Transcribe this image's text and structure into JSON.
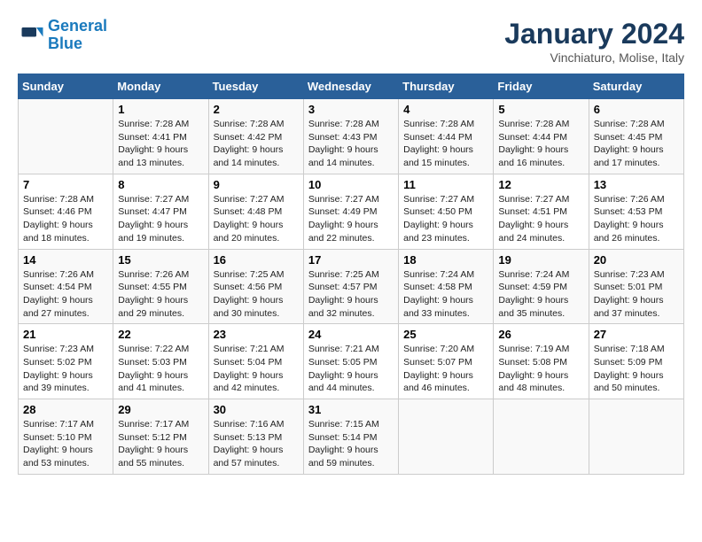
{
  "logo": {
    "line1": "General",
    "line2": "Blue"
  },
  "title": "January 2024",
  "subtitle": "Vinchiaturo, Molise, Italy",
  "days_of_week": [
    "Sunday",
    "Monday",
    "Tuesday",
    "Wednesday",
    "Thursday",
    "Friday",
    "Saturday"
  ],
  "weeks": [
    [
      {
        "day": "",
        "empty": true
      },
      {
        "day": "1",
        "sunrise": "7:28 AM",
        "sunset": "4:41 PM",
        "daylight": "9 hours and 13 minutes."
      },
      {
        "day": "2",
        "sunrise": "7:28 AM",
        "sunset": "4:42 PM",
        "daylight": "9 hours and 14 minutes."
      },
      {
        "day": "3",
        "sunrise": "7:28 AM",
        "sunset": "4:43 PM",
        "daylight": "9 hours and 14 minutes."
      },
      {
        "day": "4",
        "sunrise": "7:28 AM",
        "sunset": "4:44 PM",
        "daylight": "9 hours and 15 minutes."
      },
      {
        "day": "5",
        "sunrise": "7:28 AM",
        "sunset": "4:44 PM",
        "daylight": "9 hours and 16 minutes."
      },
      {
        "day": "6",
        "sunrise": "7:28 AM",
        "sunset": "4:45 PM",
        "daylight": "9 hours and 17 minutes."
      }
    ],
    [
      {
        "day": "7",
        "sunrise": "7:28 AM",
        "sunset": "4:46 PM",
        "daylight": "9 hours and 18 minutes."
      },
      {
        "day": "8",
        "sunrise": "7:27 AM",
        "sunset": "4:47 PM",
        "daylight": "9 hours and 19 minutes."
      },
      {
        "day": "9",
        "sunrise": "7:27 AM",
        "sunset": "4:48 PM",
        "daylight": "9 hours and 20 minutes."
      },
      {
        "day": "10",
        "sunrise": "7:27 AM",
        "sunset": "4:49 PM",
        "daylight": "9 hours and 22 minutes."
      },
      {
        "day": "11",
        "sunrise": "7:27 AM",
        "sunset": "4:50 PM",
        "daylight": "9 hours and 23 minutes."
      },
      {
        "day": "12",
        "sunrise": "7:27 AM",
        "sunset": "4:51 PM",
        "daylight": "9 hours and 24 minutes."
      },
      {
        "day": "13",
        "sunrise": "7:26 AM",
        "sunset": "4:53 PM",
        "daylight": "9 hours and 26 minutes."
      }
    ],
    [
      {
        "day": "14",
        "sunrise": "7:26 AM",
        "sunset": "4:54 PM",
        "daylight": "9 hours and 27 minutes."
      },
      {
        "day": "15",
        "sunrise": "7:26 AM",
        "sunset": "4:55 PM",
        "daylight": "9 hours and 29 minutes."
      },
      {
        "day": "16",
        "sunrise": "7:25 AM",
        "sunset": "4:56 PM",
        "daylight": "9 hours and 30 minutes."
      },
      {
        "day": "17",
        "sunrise": "7:25 AM",
        "sunset": "4:57 PM",
        "daylight": "9 hours and 32 minutes."
      },
      {
        "day": "18",
        "sunrise": "7:24 AM",
        "sunset": "4:58 PM",
        "daylight": "9 hours and 33 minutes."
      },
      {
        "day": "19",
        "sunrise": "7:24 AM",
        "sunset": "4:59 PM",
        "daylight": "9 hours and 35 minutes."
      },
      {
        "day": "20",
        "sunrise": "7:23 AM",
        "sunset": "5:01 PM",
        "daylight": "9 hours and 37 minutes."
      }
    ],
    [
      {
        "day": "21",
        "sunrise": "7:23 AM",
        "sunset": "5:02 PM",
        "daylight": "9 hours and 39 minutes."
      },
      {
        "day": "22",
        "sunrise": "7:22 AM",
        "sunset": "5:03 PM",
        "daylight": "9 hours and 41 minutes."
      },
      {
        "day": "23",
        "sunrise": "7:21 AM",
        "sunset": "5:04 PM",
        "daylight": "9 hours and 42 minutes."
      },
      {
        "day": "24",
        "sunrise": "7:21 AM",
        "sunset": "5:05 PM",
        "daylight": "9 hours and 44 minutes."
      },
      {
        "day": "25",
        "sunrise": "7:20 AM",
        "sunset": "5:07 PM",
        "daylight": "9 hours and 46 minutes."
      },
      {
        "day": "26",
        "sunrise": "7:19 AM",
        "sunset": "5:08 PM",
        "daylight": "9 hours and 48 minutes."
      },
      {
        "day": "27",
        "sunrise": "7:18 AM",
        "sunset": "5:09 PM",
        "daylight": "9 hours and 50 minutes."
      }
    ],
    [
      {
        "day": "28",
        "sunrise": "7:17 AM",
        "sunset": "5:10 PM",
        "daylight": "9 hours and 53 minutes."
      },
      {
        "day": "29",
        "sunrise": "7:17 AM",
        "sunset": "5:12 PM",
        "daylight": "9 hours and 55 minutes."
      },
      {
        "day": "30",
        "sunrise": "7:16 AM",
        "sunset": "5:13 PM",
        "daylight": "9 hours and 57 minutes."
      },
      {
        "day": "31",
        "sunrise": "7:15 AM",
        "sunset": "5:14 PM",
        "daylight": "9 hours and 59 minutes."
      },
      {
        "day": "",
        "empty": true
      },
      {
        "day": "",
        "empty": true
      },
      {
        "day": "",
        "empty": true
      }
    ]
  ]
}
